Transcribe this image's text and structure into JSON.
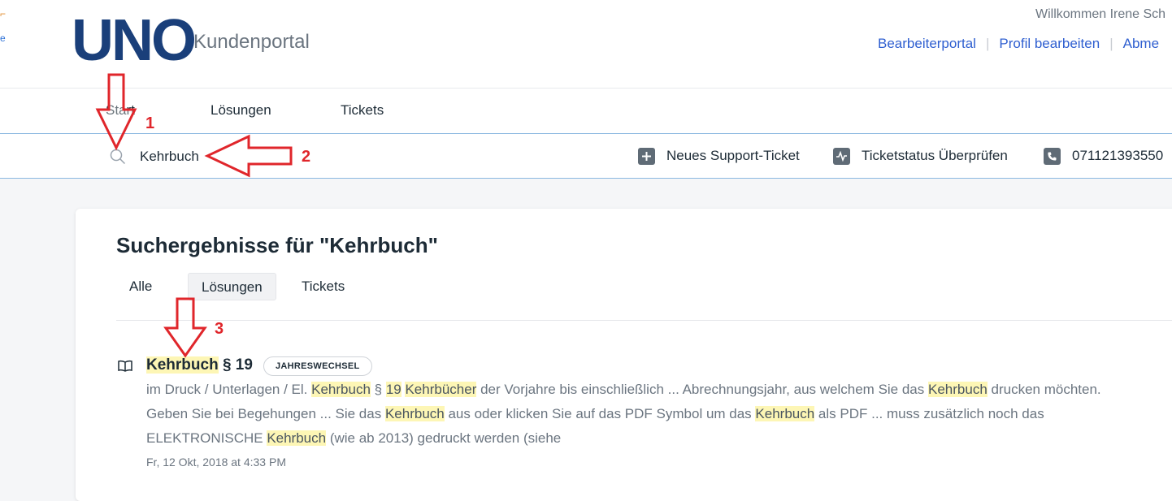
{
  "header": {
    "logo_text": "UNO",
    "portal_name": "Kundenportal",
    "welcome": "Willkommen Irene Sch",
    "links": [
      "Bearbeiterportal",
      "Profil bearbeiten",
      "Abme"
    ],
    "colors": {
      "logo": "#1a3f7a",
      "link": "#2f5fd0"
    }
  },
  "nav": {
    "items": [
      "Start",
      "Lösungen",
      "Tickets"
    ]
  },
  "search": {
    "value": "Kehrbuch",
    "icon": "search-icon",
    "actions": [
      {
        "label": "Neues Support-Ticket",
        "icon": "plus-icon"
      },
      {
        "label": "Ticketstatus Überprüfen",
        "icon": "activity-icon"
      },
      {
        "label": "071121393550",
        "icon": "phone-icon"
      }
    ]
  },
  "results": {
    "heading": "Suchergebnisse für \"Kehrbuch\"",
    "tabs": [
      "Alle",
      "Lösungen",
      "Tickets"
    ],
    "active_tab": "Lösungen",
    "items": [
      {
        "icon": "book-icon",
        "title_highlight": "Kehrbuch",
        "title_rest": " § 19",
        "badge": "JAHRESWECHSEL",
        "snippet_line1": [
          "im Druck / Unterlagen / El. ",
          "Kehrbuch",
          " § ",
          "19",
          " ",
          "Kehrbücher",
          " der Vorjahre bis einschließlich ... Abrechnungsjahr, aus welchem Sie das ",
          "Kehrbuch",
          " drucken möchten."
        ],
        "snippet_line2": [
          "Geben Sie bei Begehungen ... Sie das ",
          "Kehrbuch",
          " aus oder klicken Sie auf das PDF Symbol um das ",
          "Kehrbuch",
          " als PDF ... muss zusätzlich noch das"
        ],
        "snippet_line3": [
          "ELEKTRONISCHE ",
          "Kehrbuch",
          " (wie ab 2013) gedruckt werden (siehe"
        ],
        "date": "Fr, 12 Okt, 2018 at 4:33 PM"
      }
    ]
  },
  "annotations": {
    "labels": [
      "1",
      "2",
      "3"
    ],
    "color": "#e0262b"
  }
}
